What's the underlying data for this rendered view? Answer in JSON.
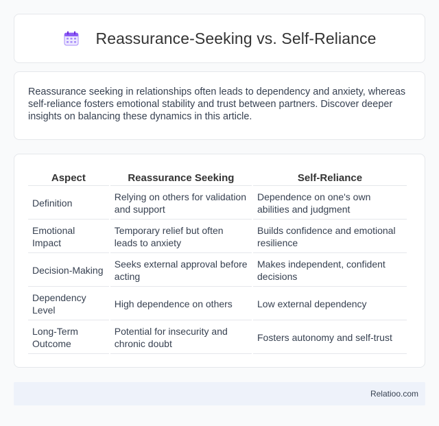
{
  "header": {
    "title": "Reassurance-Seeking vs. Self-Reliance",
    "icon": "calendar-icon"
  },
  "intro": {
    "text": "Reassurance seeking in relationships often leads to dependency and anxiety, whereas self-reliance fosters emotional stability and trust between partners. Discover deeper insights on balancing these dynamics in this article."
  },
  "table": {
    "headers": [
      "Aspect",
      "Reassurance Seeking",
      "Self-Reliance"
    ],
    "rows": [
      [
        "Definition",
        "Relying on others for validation and support",
        "Dependence on one's own abilities and judgment"
      ],
      [
        "Emotional Impact",
        "Temporary relief but often leads to anxiety",
        "Builds confidence and emotional resilience"
      ],
      [
        "Decision-Making",
        "Seeks external approval before acting",
        "Makes independent, confident decisions"
      ],
      [
        "Dependency Level",
        "High dependence on others",
        "Low external dependency"
      ],
      [
        "Long-Term Outcome",
        "Potential for insecurity and chronic doubt",
        "Fosters autonomy and self-trust"
      ]
    ]
  },
  "footer": {
    "brand": "Relatioo.com"
  },
  "colors": {
    "icon_purple": "#8b5cf6",
    "icon_light": "#ede9fe",
    "footer_bg": "#eef2fa"
  }
}
